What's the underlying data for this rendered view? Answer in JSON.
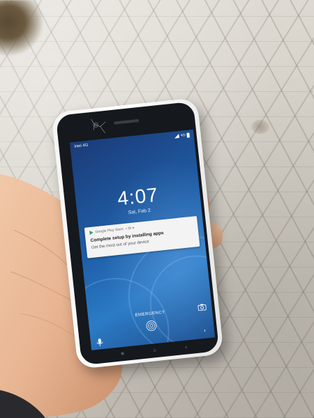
{
  "scene": {
    "description_icons": [
      "hand",
      "smartphone",
      "tiled-floor"
    ]
  },
  "status_bar": {
    "carrier": "inwi 4G",
    "network": "4G"
  },
  "lock_screen": {
    "time": "4:07",
    "date": "Sat, Feb 2"
  },
  "notification": {
    "app": "Google Play Store",
    "meta": "• 3h ▾",
    "title": "Complete setup by installing apps",
    "body": "Get the most out of your device"
  },
  "bottom": {
    "emergency": "EMERGENCY",
    "back_glyph": "‹"
  },
  "nav": {
    "menu_glyph": "≡",
    "home_glyph": "○",
    "back_glyph": "‹"
  },
  "colors": {
    "wallpaper_dark": "#1b3b78",
    "wallpaper_light": "#2c7bc6",
    "play_store_green": "#2f9e5a"
  }
}
